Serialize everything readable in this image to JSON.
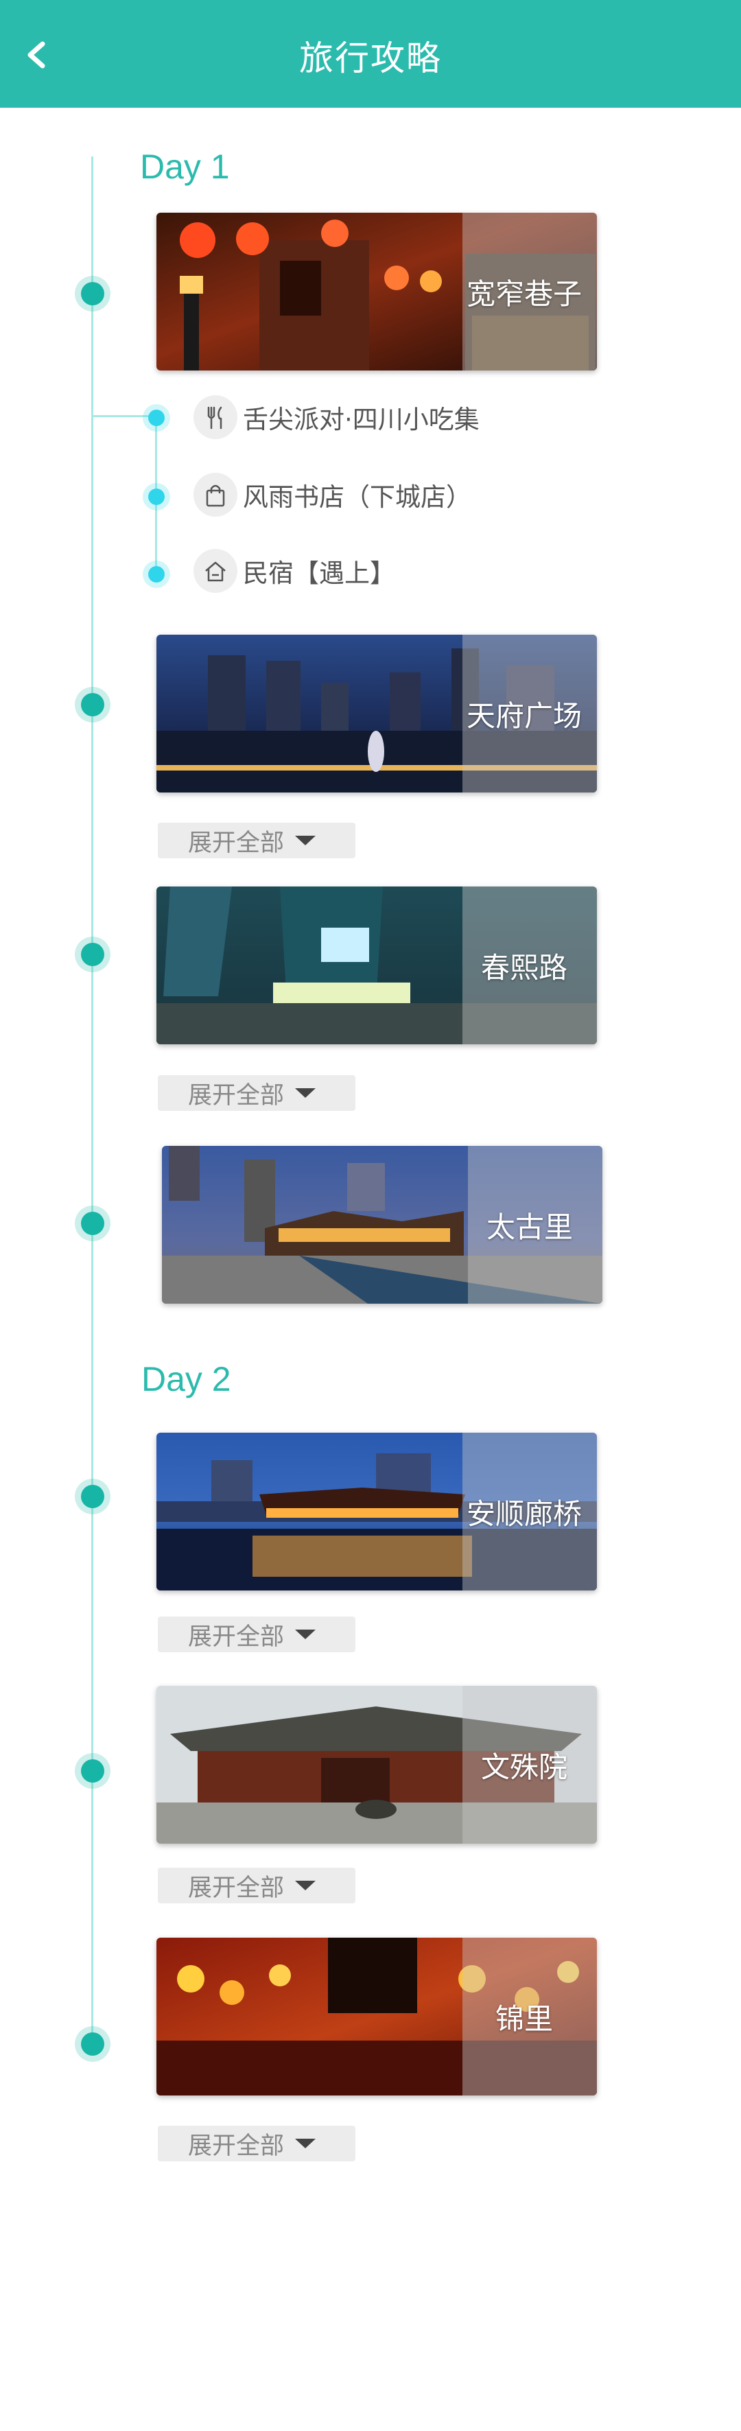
{
  "header": {
    "title": "旅行攻略"
  },
  "days": [
    {
      "label": "Day 1"
    },
    {
      "label": "Day 2"
    }
  ],
  "spots": [
    {
      "name": "宽窄巷子"
    },
    {
      "name": "天府广场"
    },
    {
      "name": "春熙路"
    },
    {
      "name": "太古里"
    },
    {
      "name": "安顺廊桥"
    },
    {
      "name": "文殊院"
    },
    {
      "name": "锦里"
    }
  ],
  "sub_items": [
    {
      "label": "舌尖派对·四川小吃集",
      "icon": "fork-knife-icon"
    },
    {
      "label": "风雨书店（下城店）",
      "icon": "shopping-bag-icon"
    },
    {
      "label": "民宿【遇上】",
      "icon": "house-icon"
    }
  ],
  "expand_label": "展开全部",
  "colors": {
    "accent": "#2BBBAD",
    "timeline": "#a8e8e3",
    "sub_dot": "#2fd5ea"
  }
}
